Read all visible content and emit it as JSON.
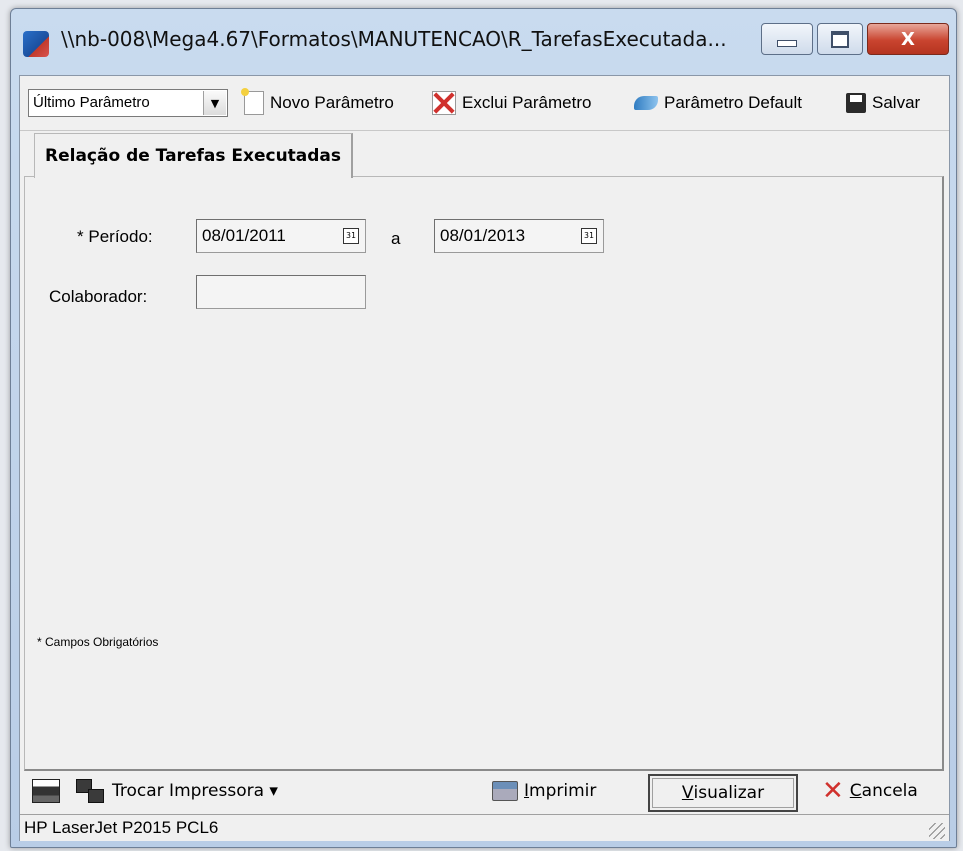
{
  "window": {
    "title": "\\\\nb-008\\Mega4.67\\Formatos\\MANUTENCAO\\R_TarefasExecutada...",
    "close_label": "X"
  },
  "toolbar": {
    "param_select": "Último Parâmetro",
    "new_param": "Novo Parâmetro",
    "delete_param": "Exclui Parâmetro",
    "default_param": "Parâmetro Default",
    "save": "Salvar"
  },
  "tabs": [
    {
      "label": "Relação de Tarefas Executadas",
      "active": true
    }
  ],
  "form": {
    "periodo_label": "Período:",
    "required_mark": "*",
    "date_from": "08/01/2011",
    "range_sep": "a",
    "date_to": "08/01/2013",
    "colaborador_label": "Colaborador:",
    "colaborador_value": "",
    "required_note": "* Campos Obrigatórios"
  },
  "bottom": {
    "change_printer": "Trocar Impressora ▾",
    "print_first": "I",
    "print_rest": "mprimir",
    "preview_first": "V",
    "preview_rest": "isualizar",
    "cancel_first": "C",
    "cancel_rest": "ancela"
  },
  "status": {
    "printer": "HP LaserJet P2015 PCL6"
  },
  "icons": [
    "app-icon",
    "new-doc-icon",
    "delete-icon",
    "default-icon",
    "save-icon",
    "printer-icon",
    "swap-printer-icon",
    "print-icon",
    "cancel-icon",
    "calendar-icon"
  ]
}
